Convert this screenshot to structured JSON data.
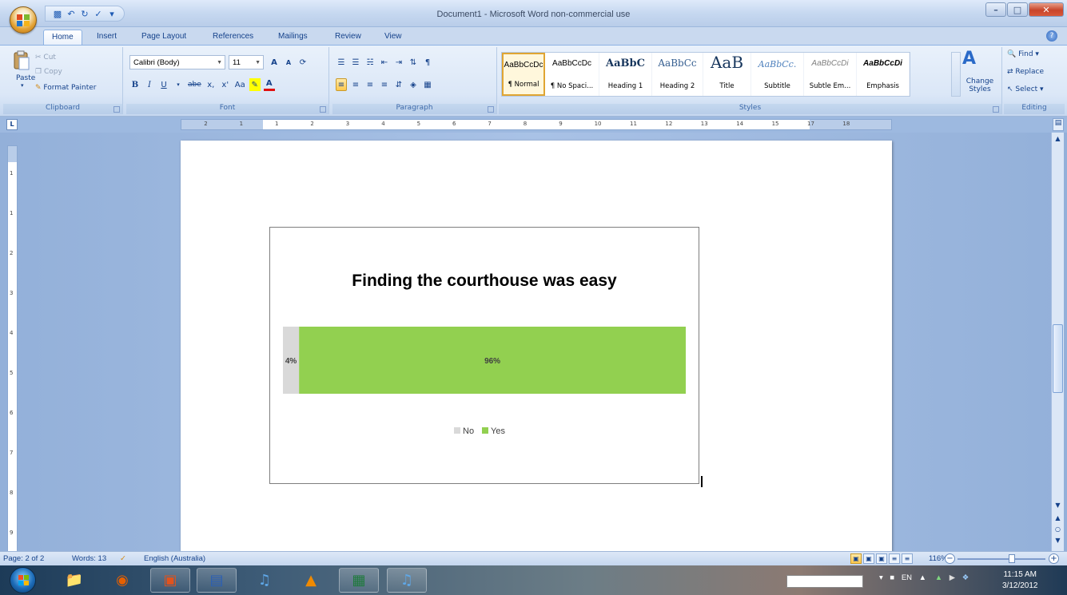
{
  "window": {
    "title": "Document1 - Microsoft Word non-commercial use"
  },
  "quick_access": {
    "icons": [
      "save-icon",
      "undo-icon",
      "redo-icon",
      "spelling-icon",
      "customize-icon"
    ]
  },
  "tabs": [
    "Home",
    "Insert",
    "Page Layout",
    "References",
    "Mailings",
    "Review",
    "View"
  ],
  "active_tab": "Home",
  "ribbon": {
    "clipboard": {
      "label": "Clipboard",
      "paste": "Paste",
      "cut": "Cut",
      "copy": "Copy",
      "format_painter": "Format Painter"
    },
    "font": {
      "label": "Font",
      "font_name": "Calibri (Body)",
      "font_size": "11",
      "bold": "B",
      "italic": "I",
      "underline": "U",
      "strikethrough": "abe",
      "subscript": "x,",
      "superscript": "x'",
      "change_case": "Aa",
      "grow": "A",
      "shrink": "A",
      "font_color": "A"
    },
    "paragraph": {
      "label": "Paragraph",
      "pilcrow": "¶"
    },
    "styles": {
      "label": "Styles",
      "items": [
        {
          "preview": "AaBbCcDc",
          "name": "¶ Normal"
        },
        {
          "preview": "AaBbCcDc",
          "name": "¶ No Spaci..."
        },
        {
          "preview": "AaBbC",
          "name": "Heading 1"
        },
        {
          "preview": "AaBbCc",
          "name": "Heading 2"
        },
        {
          "preview": "AaB",
          "name": "Title"
        },
        {
          "preview": "AaBbCc.",
          "name": "Subtitle"
        },
        {
          "preview": "AaBbCcDi",
          "name": "Subtle Em..."
        },
        {
          "preview": "AaBbCcDi",
          "name": "Emphasis"
        }
      ],
      "change_styles": "Change Styles"
    },
    "editing": {
      "label": "Editing",
      "find": "Find",
      "replace": "Replace",
      "select": "Select"
    }
  },
  "ruler": {
    "numbers": [
      "2",
      "1",
      "1",
      "2",
      "3",
      "4",
      "5",
      "6",
      "7",
      "8",
      "9",
      "10",
      "11",
      "12",
      "13",
      "14",
      "15",
      "17",
      "18"
    ],
    "vertical_numbers": [
      "1",
      "1",
      "2",
      "3",
      "4",
      "5",
      "6",
      "7",
      "8",
      "9"
    ]
  },
  "chart_data": {
    "type": "bar",
    "orientation": "horizontal",
    "stacked": "100%",
    "title": "Finding the courthouse was easy",
    "categories": [
      ""
    ],
    "series": [
      {
        "name": "No",
        "values": [
          4
        ],
        "color": "#d9d9d9",
        "data_label": "4%"
      },
      {
        "name": "Yes",
        "values": [
          96
        ],
        "color": "#92d050",
        "data_label": "96%"
      }
    ],
    "xlim": [
      0,
      100
    ],
    "legend_position": "bottom",
    "grid": false
  },
  "statusbar": {
    "page": "Page: 2 of 2",
    "words": "Words: 13",
    "language": "English (Australia)",
    "zoom": "116%"
  },
  "taskbar": {
    "icons": [
      "explorer-icon",
      "firefox-icon",
      "calendar-app-icon",
      "word-icon",
      "itunes-icon",
      "vlc-icon",
      "excel-icon",
      "itunes-icon-2"
    ],
    "tray_lang": "EN",
    "time": "11:15 AM",
    "date": "3/12/2012"
  },
  "colors": {
    "ribbon_text": "#15428b",
    "no": "#d9d9d9",
    "yes": "#92d050"
  }
}
